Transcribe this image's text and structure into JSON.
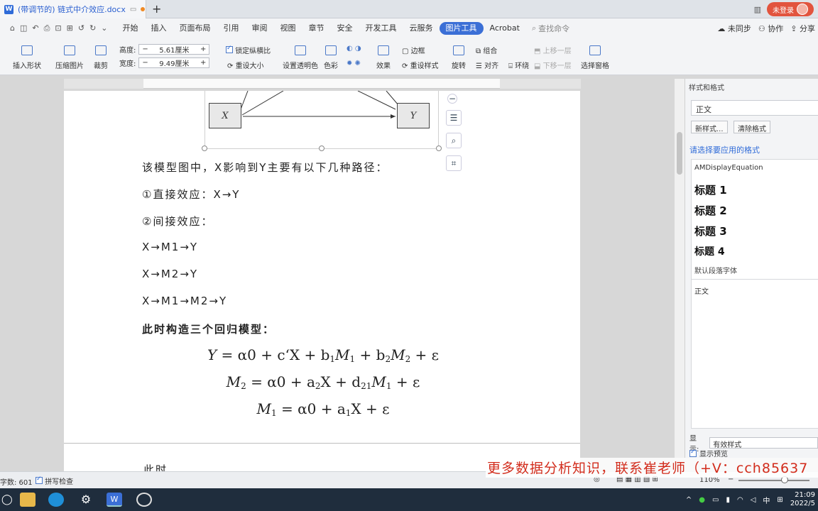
{
  "window": {
    "tab_title": "(带调节的) 链式中介效应.docx",
    "word_icon": "W",
    "new_tab": "+",
    "login_label": "未登录"
  },
  "quick_access": [
    "⌂",
    "◫",
    "↶",
    "⎙",
    "⊡",
    "⊞",
    "↺",
    "↻",
    "⌄"
  ],
  "menus": [
    "开始",
    "插入",
    "页面布局",
    "引用",
    "审阅",
    "视图",
    "章节",
    "安全",
    "开发工具",
    "云服务",
    "图片工具",
    "Acrobat"
  ],
  "active_menu": "图片工具",
  "search": {
    "placeholder": "查找命令"
  },
  "menu_right": {
    "sync": "未同步",
    "collab": "协作",
    "share": "分享"
  },
  "ribbon": {
    "insert_shape": "插入形状",
    "compress": "压缩图片",
    "crop": "裁剪",
    "height_label": "高度:",
    "height_value": "5.61厘米",
    "width_label": "宽度:",
    "width_value": "9.49厘米",
    "lock_ratio": "锁定纵横比",
    "reset_size": "重设大小",
    "set_transparent": "设置透明色",
    "color": "色彩",
    "effect": "效果",
    "border": "边框",
    "reset_style": "重设样式",
    "rotate": "旋转",
    "group": "组合",
    "align": "对齐",
    "wrap": "环绕",
    "up_layer": "上移一层",
    "down_layer": "下移一层",
    "select_pane": "选择窗格"
  },
  "doc": {
    "diagram_x": "X",
    "diagram_y": "Y",
    "line1": "该模型图中，X影响到Y主要有以下几种路径：",
    "line2": "①直接效应：X→Y",
    "line3": "②间接效应：",
    "line4": "X→M1→Y",
    "line5": "X→M2→Y",
    "line6": "X→M1→M2→Y",
    "line7": "此时构造三个回归模型：",
    "page2_text": "此时"
  },
  "equations": {
    "eq1_lhs": "Y",
    "eq1_rhs": "= α0 + c‘X + b",
    "eq1_sub1": "1",
    "eq1_m": "M",
    "eq1_sub2": "1",
    "eq1_rest": " + b",
    "eq1_sub3": "2",
    "eq1_m2": "M",
    "eq1_sub4": "2",
    "eq1_end": " + ε",
    "eq2_lhs": "M",
    "eq2_lsub": "2",
    "eq2_rhs": " = α0 + a",
    "eq2_sub1": "2",
    "eq2_x": "X + d",
    "eq2_sub2": "21",
    "eq2_m": "M",
    "eq2_sub3": "1",
    "eq2_end": " + ε",
    "eq3_lhs": "M",
    "eq3_lsub": "1",
    "eq3_rhs": " = α0 + a",
    "eq3_sub1": "1",
    "eq3_end": "X + ε"
  },
  "side_panel": {
    "title": "样式和格式",
    "current_style": "正文",
    "new_style": "新样式...",
    "clear_format": "清除格式",
    "hint": "请选择要应用的格式",
    "styles": [
      "AMDisplayEquation",
      "标题 1",
      "标题 2",
      "标题 3",
      "标题 4",
      "默认段落字体",
      "正文"
    ],
    "show_label": "显示:",
    "show_value": "有效样式",
    "preview_label": "显示预览"
  },
  "status": {
    "word_count": "字数: 601",
    "spell_check": "拼写检查",
    "zoom": "110%"
  },
  "overlay": "更多数据分析知识，联系崔老师（+V：cch85637",
  "taskbar": {
    "time": "21:09",
    "date": "2022/5",
    "ime": "中"
  }
}
